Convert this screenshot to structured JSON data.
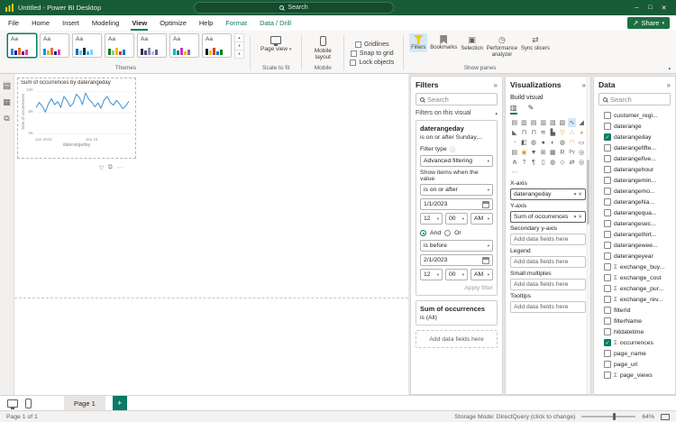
{
  "colors": {
    "titlebar_green": "#185c37",
    "accent_teal": "#0b7a66",
    "share_green": "#1d6f42",
    "chart_line": "#3f92d2",
    "selected_button_bg": "#d5e8f7",
    "funnel_yellow": "#f2c811"
  },
  "titlebar": {
    "app_title": "Untitled - Power BI Desktop",
    "search_placeholder": "Search"
  },
  "menubar": {
    "tabs": [
      {
        "label": "File"
      },
      {
        "label": "Home"
      },
      {
        "label": "Insert"
      },
      {
        "label": "Modeling"
      },
      {
        "label": "View",
        "active": true
      },
      {
        "label": "Optimize"
      },
      {
        "label": "Help"
      },
      {
        "label": "Format",
        "contextual": true
      },
      {
        "label": "Data / Drill",
        "contextual": true
      }
    ],
    "share_label": "Share"
  },
  "ribbon": {
    "theme_sample_text": "Aa",
    "themes": [
      {
        "selected": true,
        "colors": [
          "#118DFF",
          "#12239E",
          "#E66C37",
          "#6B007B",
          "#E044A7"
        ]
      },
      {
        "colors": [
          "#118DFF",
          "#B3C833",
          "#E66C37",
          "#12239E",
          "#E044A7"
        ]
      },
      {
        "colors": [
          "#0F6CBD",
          "#77BDEA",
          "#072F49",
          "#31B6FD",
          "#8AD4EB"
        ]
      },
      {
        "colors": [
          "#107C10",
          "#94CF84",
          "#FFB900",
          "#D83B01",
          "#0078D4"
        ]
      },
      {
        "colors": [
          "#31314E",
          "#4C4C78",
          "#8A8AB5",
          "#BDBDD6",
          "#605E97"
        ]
      },
      {
        "colors": [
          "#00B7C3",
          "#038387",
          "#C239B3",
          "#FFB900",
          "#8764B8"
        ]
      },
      {
        "colors": [
          "#1B1A19",
          "#FFB900",
          "#D83B01",
          "#0078D4",
          "#107C10"
        ]
      }
    ],
    "themes_label": "Themes",
    "page_view_label": "Page view",
    "scale_group_label": "Scale to fit",
    "mobile_layout_label": "Mobile layout",
    "mobile_group_label": "Mobile",
    "checkboxes": [
      {
        "label": "Gridlines",
        "checked": false
      },
      {
        "label": "Snap to grid",
        "checked": false
      },
      {
        "label": "Lock objects",
        "checked": false
      }
    ],
    "pane_buttons": [
      {
        "label": "Filters",
        "active": true
      },
      {
        "label": "Bookmarks"
      },
      {
        "label": "Selection"
      },
      {
        "label": "Performance analyzer"
      },
      {
        "label": "Sync slicers"
      }
    ],
    "show_panes_label": "Show panes"
  },
  "chart_data": {
    "type": "line",
    "title": "Sum of occurrences by daterangeday",
    "xlabel": "daterangeday",
    "ylabel": "Sum of occurrences",
    "x_ticks": [
      "Jan 2023",
      "Jan 15"
    ],
    "y_ticks": [
      "0K",
      "5K",
      "10K"
    ],
    "ylim": [
      0,
      10000
    ],
    "values": [
      6200,
      7400,
      6600,
      5200,
      7100,
      8300,
      6900,
      7600,
      6300,
      8800,
      7900,
      6500,
      7200,
      9300,
      8600,
      7000,
      9600,
      8200,
      7500,
      6400,
      7300,
      6100,
      8000,
      8800,
      7400,
      6800,
      7900,
      7100,
      6000,
      6600,
      7700
    ]
  },
  "filters_pane": {
    "title": "Filters",
    "search_placeholder": "Search",
    "section_label": "Filters on this visual",
    "card1": {
      "field": "daterangeday",
      "summary": "is on or after Sunday,...",
      "filter_type_label": "Filter type",
      "filter_type_value": "Advanced filtering",
      "show_items_label": "Show items when the value",
      "condition1": "is on or after",
      "date1": "1/1/2023",
      "time1": {
        "hour": "12",
        "minute": "00",
        "ampm": "AM"
      },
      "and_label": "And",
      "or_label": "Or",
      "condition2": "is before",
      "date2": "2/1/2023",
      "time2": {
        "hour": "12",
        "minute": "00",
        "ampm": "AM"
      },
      "apply_label": "Apply filter"
    },
    "card2": {
      "field": "Sum of occurrences",
      "summary": "is (All)"
    },
    "add_fields_label": "Add data fields here"
  },
  "viz_pane": {
    "title": "Visualizations",
    "build_label": "Build visual",
    "icons": [
      {
        "name": "stacked-bar-chart",
        "glyph": "▤"
      },
      {
        "name": "stacked-column-chart",
        "glyph": "▥"
      },
      {
        "name": "clustered-bar-chart",
        "glyph": "▤"
      },
      {
        "name": "clustered-column-chart",
        "glyph": "▥"
      },
      {
        "name": "100-stacked-bar-chart",
        "glyph": "▧"
      },
      {
        "name": "100-stacked-column-chart",
        "glyph": "▨"
      },
      {
        "name": "line-chart",
        "glyph": "∿",
        "selected": true
      },
      {
        "name": "area-chart",
        "glyph": "◢"
      },
      {
        "name": "stacked-area-chart",
        "glyph": "◣"
      },
      {
        "name": "line-and-stacked-column-chart",
        "glyph": "⊓"
      },
      {
        "name": "line-and-clustered-column-chart",
        "glyph": "⊓"
      },
      {
        "name": "ribbon-chart",
        "glyph": "≋"
      },
      {
        "name": "waterfall-chart",
        "glyph": "▙"
      },
      {
        "name": "funnel-chart",
        "glyph": "▽",
        "color": "#c9a227"
      },
      {
        "name": "scatter-chart",
        "glyph": "∴"
      },
      {
        "name": "pie-chart",
        "glyph": "◕",
        "color": "#c9a227"
      },
      {
        "name": "donut-chart",
        "glyph": "◔",
        "color": "#c9a227"
      },
      {
        "name": "treemap",
        "glyph": "◧"
      },
      {
        "name": "map",
        "glyph": "◍"
      },
      {
        "name": "filled-map",
        "glyph": "●"
      },
      {
        "name": "shape-map",
        "glyph": "◐"
      },
      {
        "name": "azure-map",
        "glyph": "◍"
      },
      {
        "name": "gauge",
        "glyph": "◠",
        "color": "#c9a227"
      },
      {
        "name": "card",
        "glyph": "▭"
      },
      {
        "name": "multi-row-card",
        "glyph": "▤"
      },
      {
        "name": "kpi",
        "glyph": "◉",
        "color": "#c9a227"
      },
      {
        "name": "slicer",
        "glyph": "▼"
      },
      {
        "name": "table",
        "glyph": "⊞"
      },
      {
        "name": "matrix",
        "glyph": "▦"
      },
      {
        "name": "r-script-visual",
        "glyph": "R"
      },
      {
        "name": "python-visual",
        "glyph": "Py"
      },
      {
        "name": "key-influencers",
        "glyph": "◎"
      },
      {
        "name": "decomposition-tree",
        "glyph": "⋔"
      },
      {
        "name": "qa-visual",
        "glyph": "?"
      },
      {
        "name": "smart-narrative",
        "glyph": "¶"
      },
      {
        "name": "paginated-report",
        "glyph": "▯"
      },
      {
        "name": "arcgis-map",
        "glyph": "◍"
      },
      {
        "name": "power-apps",
        "glyph": "◇"
      },
      {
        "name": "power-automate",
        "glyph": "⇄"
      },
      {
        "name": "metrics",
        "glyph": "◎"
      },
      {
        "name": "get-more-visuals",
        "glyph": "⋯"
      }
    ],
    "wells": [
      {
        "label": "X-axis",
        "field": "daterangeday"
      },
      {
        "label": "Y-axis",
        "field": "Sum of occurrences"
      },
      {
        "label": "Secondary y-axis",
        "placeholder": "Add data fields here"
      },
      {
        "label": "Legend",
        "placeholder": "Add data fields here"
      },
      {
        "label": "Small multiples",
        "placeholder": "Add data fields here"
      },
      {
        "label": "Tooltips",
        "placeholder": "Add data fields here"
      }
    ]
  },
  "data_pane": {
    "title": "Data",
    "search_placeholder": "Search",
    "fields": [
      {
        "name": "customer_regi..."
      },
      {
        "name": "daterange"
      },
      {
        "name": "daterangeday",
        "checked": true
      },
      {
        "name": "daterangefifte..."
      },
      {
        "name": "daterangefive..."
      },
      {
        "name": "daterangehour"
      },
      {
        "name": "daterangemin..."
      },
      {
        "name": "daterangemo..."
      },
      {
        "name": "daterangeNa..."
      },
      {
        "name": "daterangequa..."
      },
      {
        "name": "daterangesec..."
      },
      {
        "name": "daterangethirt..."
      },
      {
        "name": "daterangewee..."
      },
      {
        "name": "daterangeyear"
      },
      {
        "name": "exchange_buy...",
        "sigma": true
      },
      {
        "name": "exchange_cost",
        "sigma": true
      },
      {
        "name": "exchange_pur...",
        "sigma": true
      },
      {
        "name": "exchange_rev...",
        "sigma": true
      },
      {
        "name": "filterId"
      },
      {
        "name": "filterName"
      },
      {
        "name": "hitdatetime"
      },
      {
        "name": "occurrences",
        "sigma": true,
        "checked": true
      },
      {
        "name": "page_name"
      },
      {
        "name": "page_url"
      },
      {
        "name": "page_views",
        "sigma": true
      }
    ]
  },
  "pagebar": {
    "page_label": "Page 1",
    "new_page_label": "+"
  },
  "statusbar": {
    "left": "Page 1 of 1",
    "storage": "Storage Mode: DirectQuery (click to change)",
    "zoom": "64%"
  }
}
